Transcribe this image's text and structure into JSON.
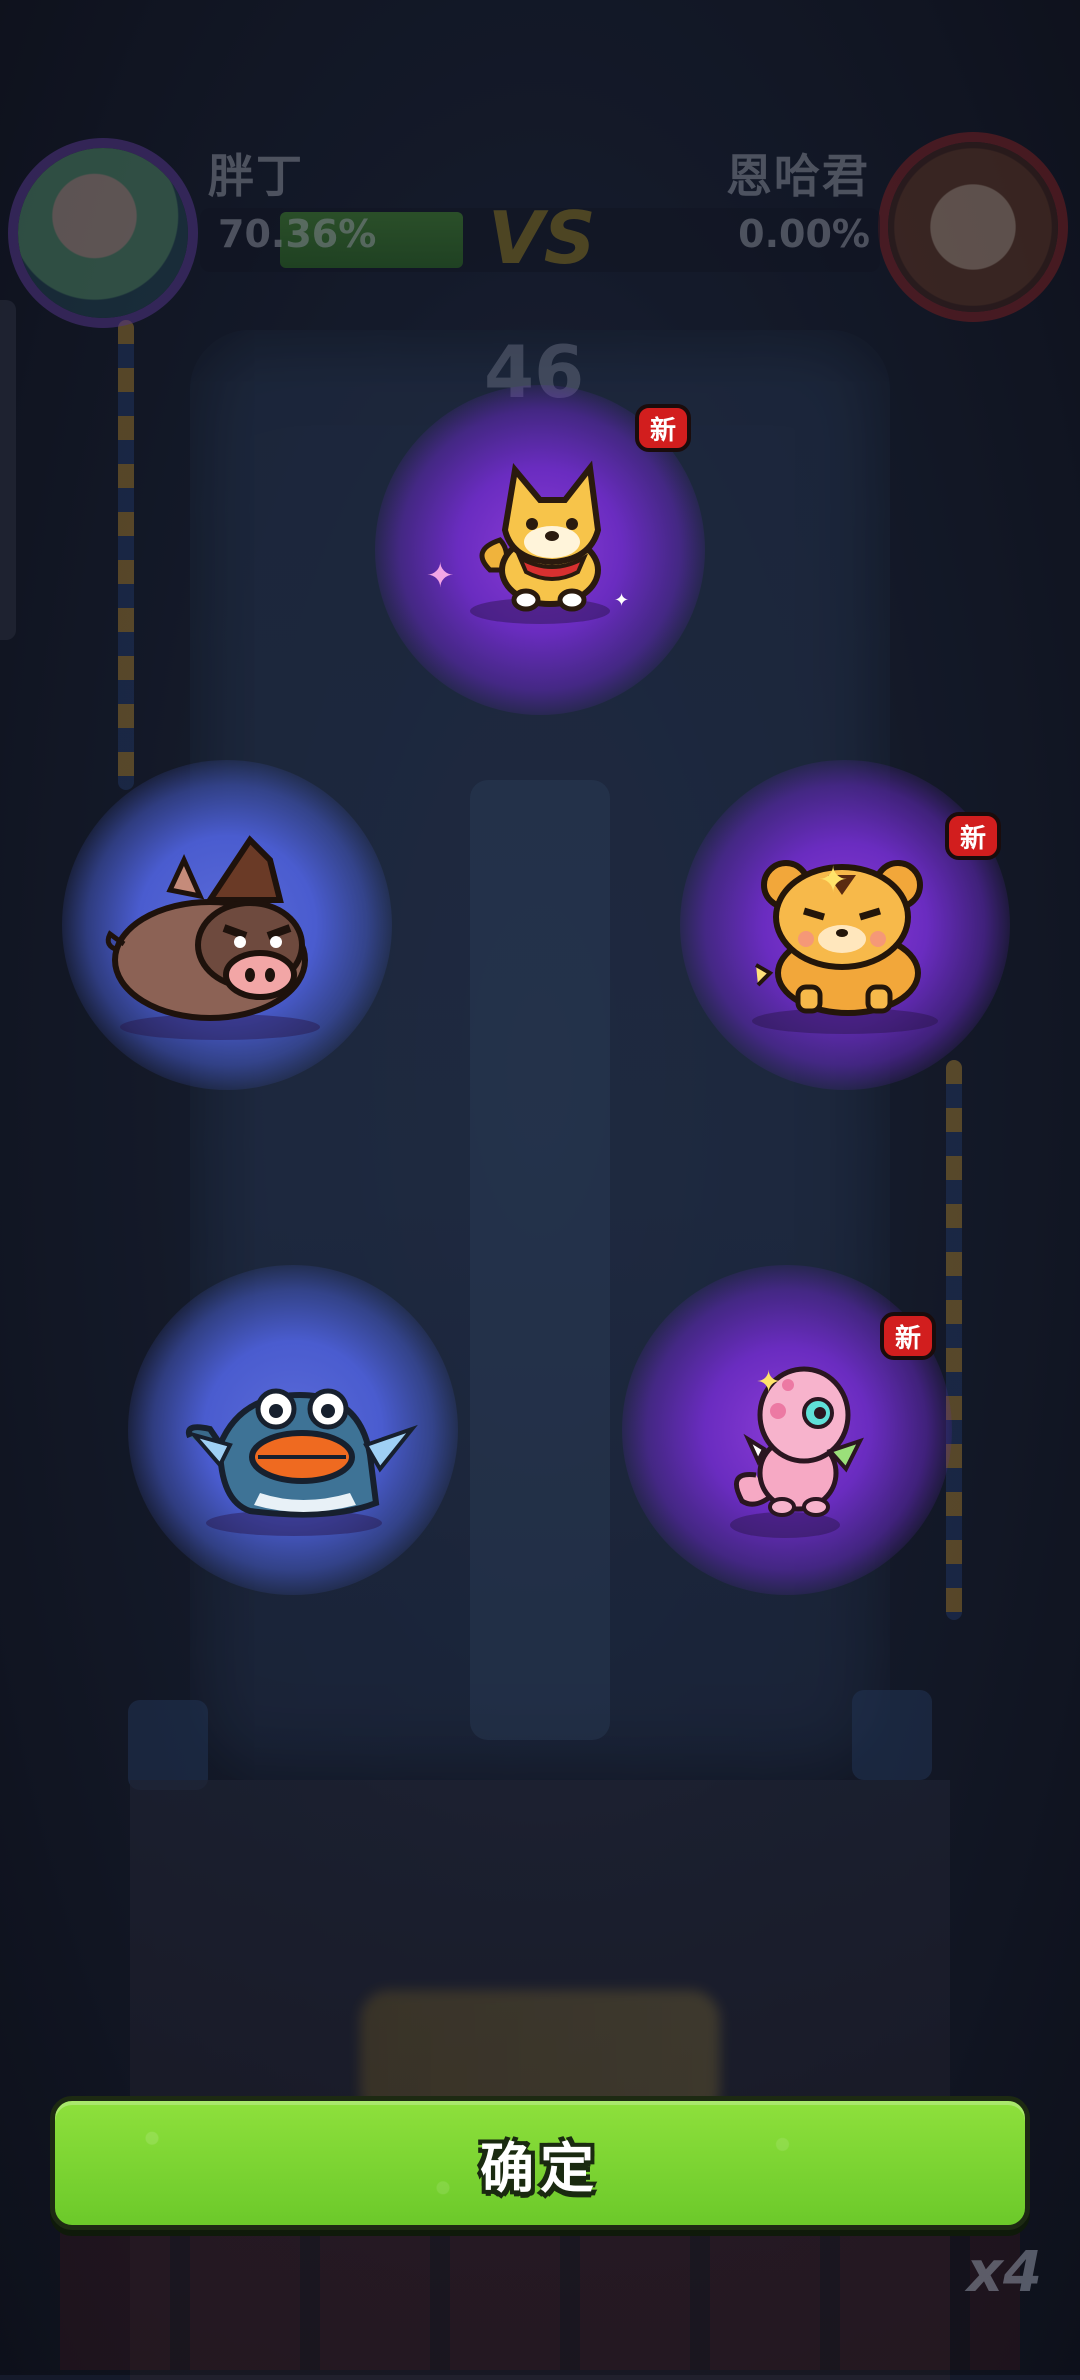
{
  "hud": {
    "left_player": {
      "name": "胖丁",
      "score": "70.36%"
    },
    "right_player": {
      "name": "恩哈君",
      "score": "0.00%"
    },
    "vs_label": "VS",
    "timer": "46"
  },
  "rewards": {
    "new_badge_label": "新",
    "pets": [
      {
        "id": "shiba-dog",
        "glow": "purple",
        "is_new": true
      },
      {
        "id": "boar",
        "glow": "blue",
        "is_new": false
      },
      {
        "id": "tiger-cub",
        "glow": "purple",
        "is_new": true
      },
      {
        "id": "blue-frog",
        "glow": "blue",
        "is_new": false
      },
      {
        "id": "pink-lizard",
        "glow": "purple",
        "is_new": true
      }
    ]
  },
  "confirm_button": {
    "label": "确定"
  },
  "speed_indicator": "x4",
  "colors": {
    "confirm_green": "#7cd532",
    "glow_purple": "#8a3bd6",
    "glow_blue": "#5a6ad8",
    "new_badge_red": "#d21e1e"
  }
}
